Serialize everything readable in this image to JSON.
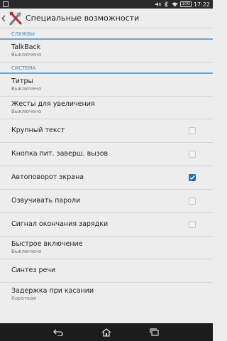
{
  "status_bar": {
    "time": "17:22",
    "battery": "100"
  },
  "header": {
    "title": "Специальные возможности"
  },
  "sections": {
    "services": {
      "header": "СЛУЖБЫ",
      "talkback": {
        "title": "TalkBack",
        "summary": "Выключено"
      }
    },
    "system": {
      "header": "СИСТЕМА",
      "captions": {
        "title": "Титры",
        "summary": "Выключено"
      },
      "magnification": {
        "title": "Жесты для увеличения",
        "summary": "Выключено"
      },
      "large_text": {
        "title": "Крупный текст",
        "checked": false
      },
      "power_button_ends_call": {
        "title": "Кнопка пит. заверш. вызов",
        "checked": false
      },
      "auto_rotate": {
        "title": "Автоповорот экрана",
        "checked": true
      },
      "speak_passwords": {
        "title": "Озвучивать пароли",
        "checked": false
      },
      "charging_sound": {
        "title": "Сигнал окончания зарядки",
        "checked": false
      },
      "quick_launch": {
        "title": "Быстрое включение",
        "summary": "Выключено"
      },
      "tts": {
        "title": "Синтез речи"
      },
      "touch_delay": {
        "title": "Задержка при касании",
        "summary": "Короткая"
      }
    }
  },
  "colors": {
    "accent": "#1e6fb5",
    "section_header": "#4a8ab8"
  }
}
